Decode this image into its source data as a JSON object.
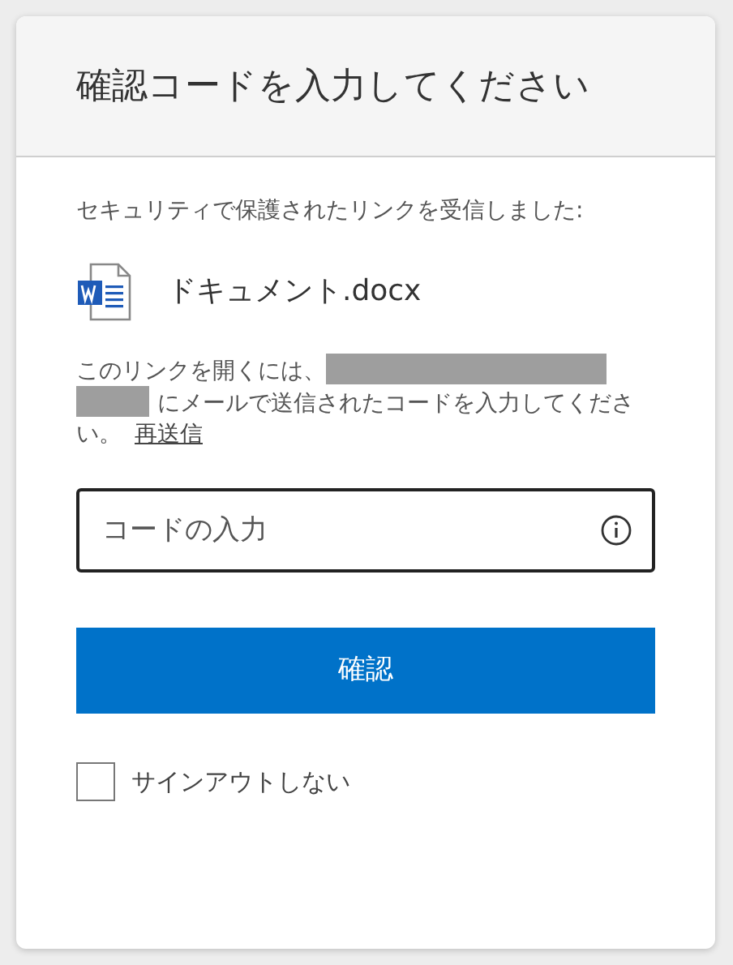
{
  "header": {
    "title": "確認コードを入力してください"
  },
  "notice": "セキュリティで保護されたリンクを受信しました:",
  "file": {
    "name": "ドキュメント.docx"
  },
  "instruction": {
    "before": "このリンクを開くには、",
    "redacted": true,
    "after": "にメールで送信されたコードを入力してください。",
    "resend_link": "再送信"
  },
  "code_field": {
    "placeholder": "コードの入力"
  },
  "confirm_button": "確認",
  "stay_signed_in": {
    "label": "サインアウトしない",
    "checked": false
  }
}
